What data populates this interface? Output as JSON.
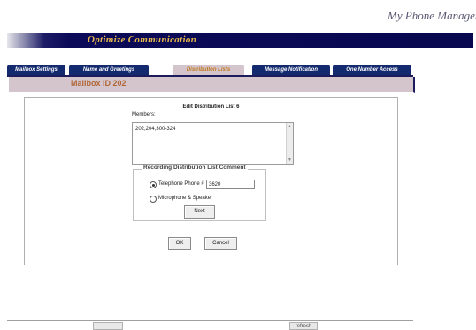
{
  "header": {
    "brand": "My Phone Manager",
    "banner_title": "Optimize Communication"
  },
  "tabs": [
    {
      "label": "Mailbox Settings",
      "active": false
    },
    {
      "label": "Name and Greetings",
      "active": false
    },
    {
      "label": "Distribution Lists",
      "active": true
    },
    {
      "label": "Message Notification",
      "active": false
    },
    {
      "label": "One Number Access",
      "active": false
    }
  ],
  "mailbox": {
    "label": "Mailbox ID 202"
  },
  "form": {
    "title": "Edit Distribution List 6",
    "members_label": "Members:",
    "members_value": "202,204,300-324",
    "recording": {
      "legend": "Recording Distribution List Comment",
      "telephone_label": "Telephone Phone #",
      "telephone_value": "3620",
      "telephone_selected": true,
      "microphone_label": "Microphone & Speaker",
      "microphone_selected": false,
      "next_label": "Next"
    },
    "ok_label": "OK",
    "cancel_label": "Cancel"
  },
  "footer": {
    "refresh_label": "refresh"
  },
  "colors": {
    "banner": "#080850",
    "banner_text": "#e6b64a",
    "tab": "#142a6e",
    "active_tab": "#d4c4cc",
    "mailbox_text": "#b06838"
  }
}
